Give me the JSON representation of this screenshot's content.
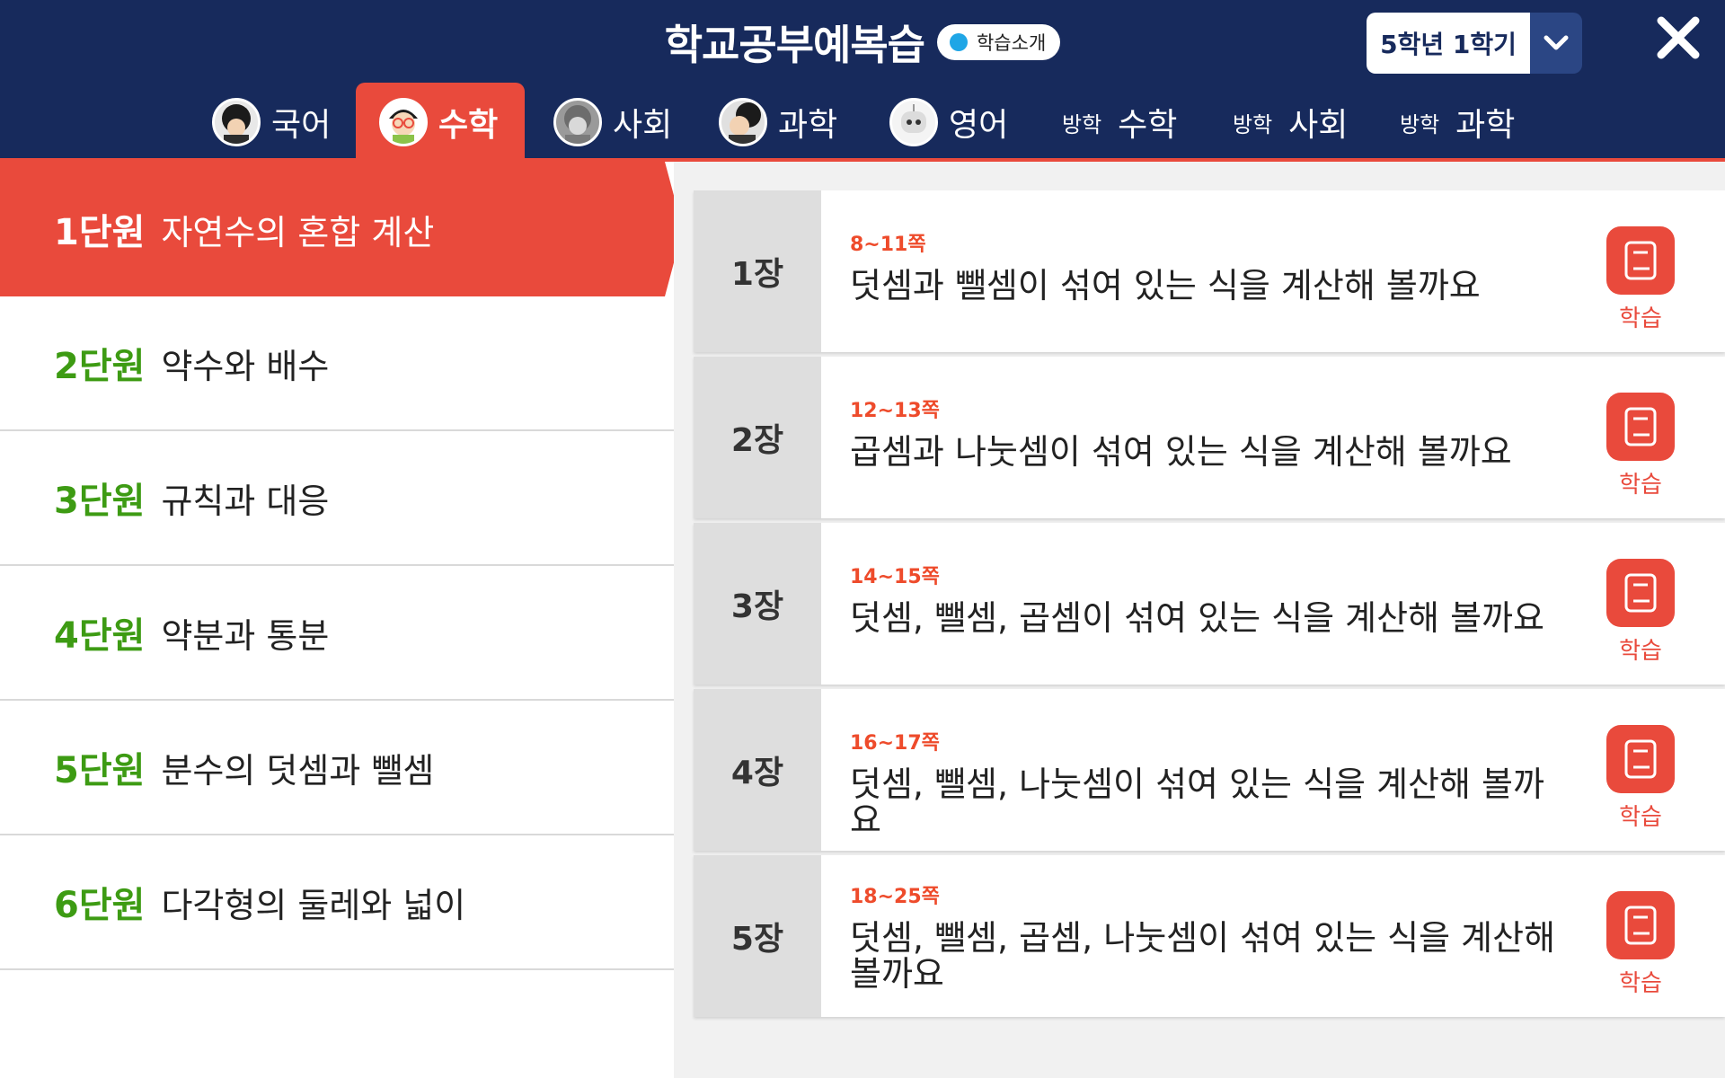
{
  "header": {
    "title": "학교공부예복습",
    "intro_label": "학습소개",
    "grade": "5학년 1학기",
    "colors": {
      "navy": "#172a5c",
      "accent": "#e94a3c",
      "green": "#3d9b13",
      "page_orange": "#ee4b2b"
    }
  },
  "tabs": [
    {
      "label": "국어",
      "icon": "student-avatar-icon"
    },
    {
      "label": "수학",
      "icon": "glasses-avatar-icon",
      "active": true
    },
    {
      "label": "사회",
      "icon": "gray-avatar-icon"
    },
    {
      "label": "과학",
      "icon": "curly-avatar-icon"
    },
    {
      "label": "영어",
      "icon": "robot-avatar-icon"
    },
    {
      "prefix": "방학",
      "label": "수학"
    },
    {
      "prefix": "방학",
      "label": "사회"
    },
    {
      "prefix": "방학",
      "label": "과학"
    }
  ],
  "units": [
    {
      "num": "1단원",
      "title": "자연수의 혼합 계산",
      "active": true
    },
    {
      "num": "2단원",
      "title": "약수와 배수"
    },
    {
      "num": "3단원",
      "title": "규칙과 대응"
    },
    {
      "num": "4단원",
      "title": "약분과 통분"
    },
    {
      "num": "5단원",
      "title": "분수의 덧셈과 뺄셈"
    },
    {
      "num": "6단원",
      "title": "다각형의 둘레와 넓이"
    }
  ],
  "chapters": [
    {
      "no": "1장",
      "pages": "8~11쪽",
      "title": "덧셈과 뺄셈이 섞여 있는 식을 계산해 볼까요",
      "learn": "학습"
    },
    {
      "no": "2장",
      "pages": "12~13쪽",
      "title": "곱셈과 나눗셈이 섞여 있는 식을 계산해 볼까요",
      "learn": "학습"
    },
    {
      "no": "3장",
      "pages": "14~15쪽",
      "title": "덧셈, 뺄셈, 곱셈이 섞여 있는 식을 계산해 볼까요",
      "learn": "학습"
    },
    {
      "no": "4장",
      "pages": "16~17쪽",
      "title": "덧셈, 뺄셈, 나눗셈이 섞여 있는 식을 계산해 볼까요",
      "learn": "학습"
    },
    {
      "no": "5장",
      "pages": "18~25쪽",
      "title": "덧셈, 뺄셈, 곱셈, 나눗셈이 섞여 있는 식을 계산해 볼까요",
      "learn": "학습"
    }
  ]
}
